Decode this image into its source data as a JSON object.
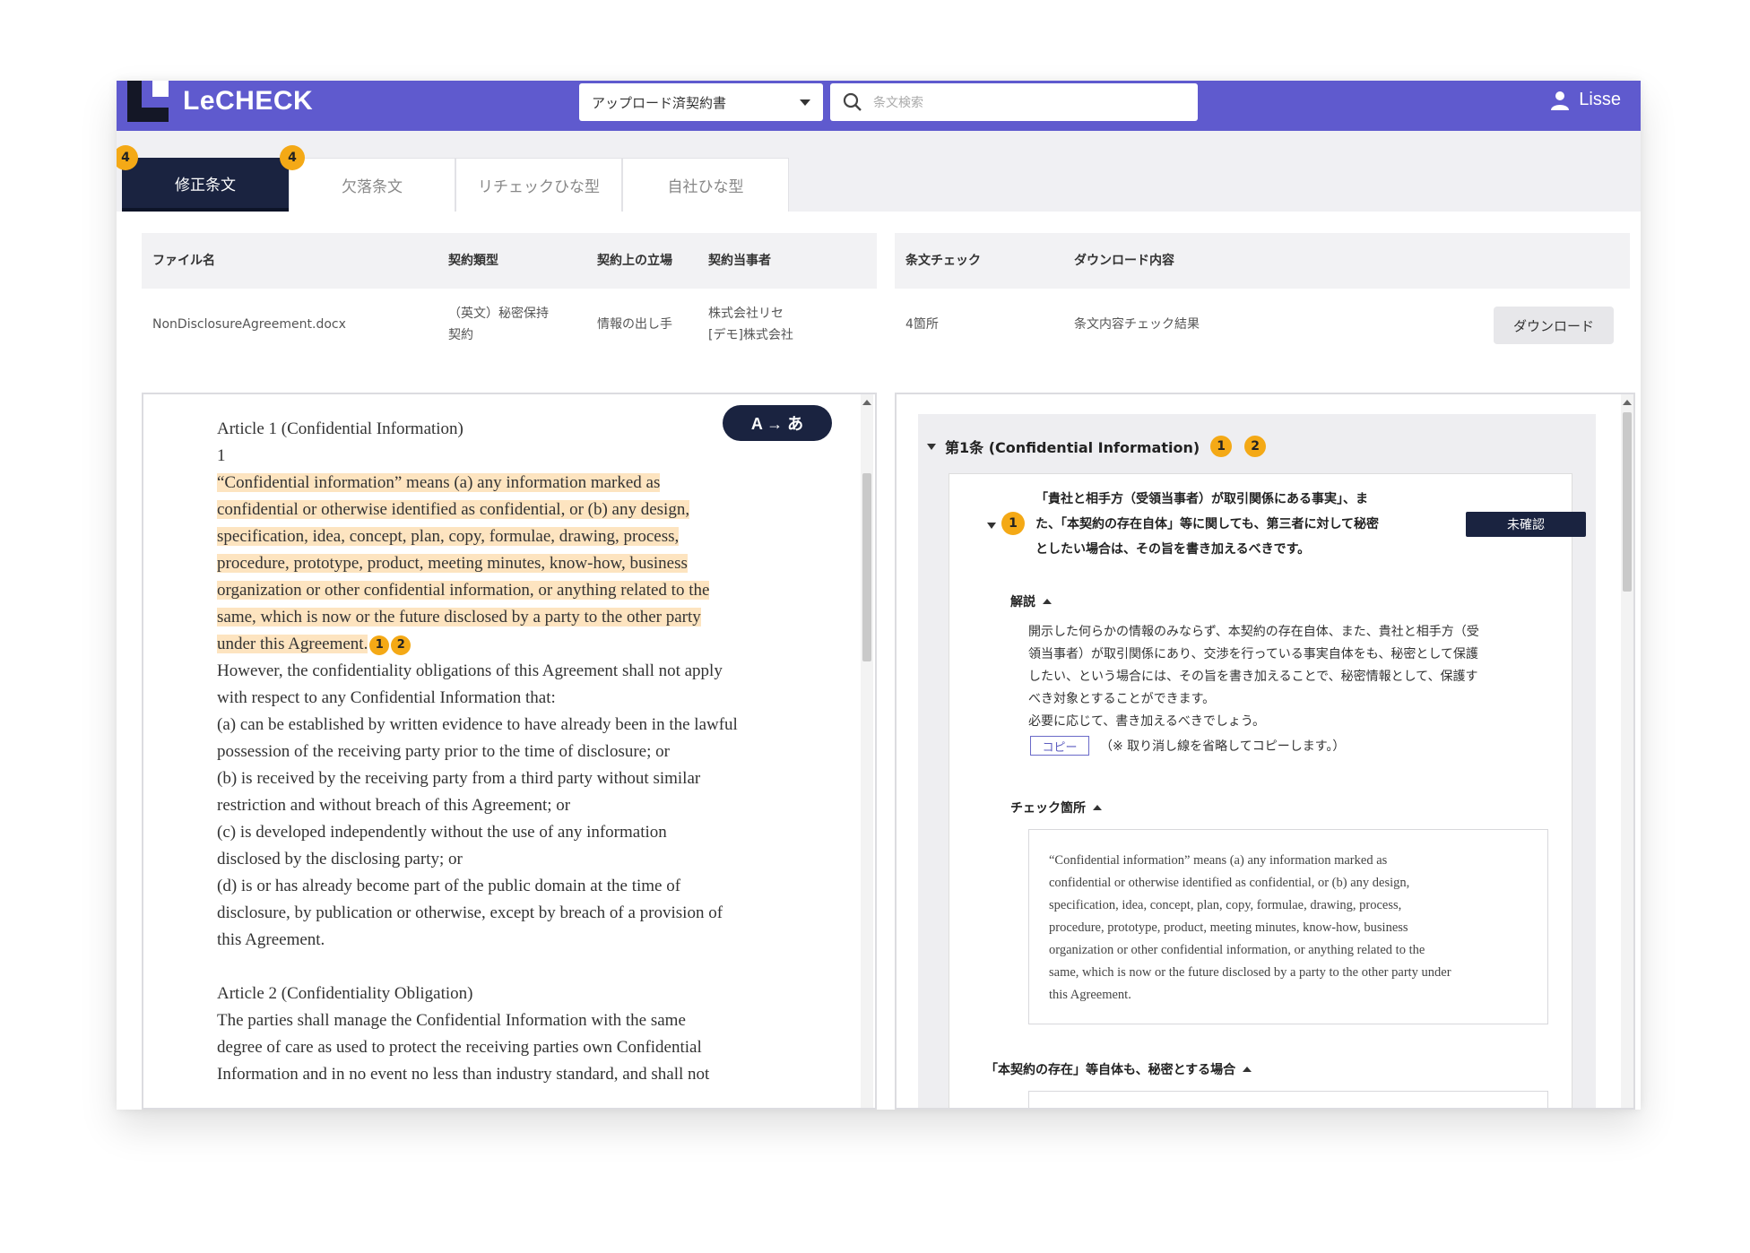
{
  "app": {
    "logo_text": "LeCHECK",
    "accent": "#5f5ace",
    "dark": "#1a2340",
    "badge_color": "#f4a916",
    "highlight": "#fde4c0"
  },
  "header": {
    "contract_select_value": "アップロード済契約書",
    "search_placeholder": "条文検索",
    "user_name": "Lisse"
  },
  "tabs": [
    {
      "label": "修正条文",
      "badge": "4"
    },
    {
      "label": "欠落条文",
      "badge": "4"
    },
    {
      "label": "リチェックひな型"
    },
    {
      "label": "自社ひな型"
    }
  ],
  "file_table": {
    "headers": {
      "file_name": "ファイル名",
      "contract_type": "契約類型",
      "position": "契約上の立場",
      "parties": "契約当事者",
      "clause_check": "条文チェック",
      "download_content": "ダウンロード内容"
    },
    "row": {
      "file_name": "NonDisclosureAgreement.docx",
      "contract_type_1": "（英文）秘密保持",
      "contract_type_2": "契約",
      "position": "情報の出し手",
      "party_1": "株式会社リセ",
      "party_2": "[デモ]株式会社",
      "clause_check": "4箇所",
      "download_content": "条文内容チェック結果",
      "download_button": "ダウンロード"
    }
  },
  "document": {
    "translate_button": "A → あ",
    "article1_title": "Article 1 (Confidential Information)",
    "article1_num": "1",
    "highlight_lines": [
      "“Confidential information” means (a) any information marked as",
      "confidential or otherwise identified as confidential, or (b) any design,",
      "specification, idea, concept, plan, copy, formulae, drawing, process,",
      "procedure, prototype, product, meeting minutes, know-how, business",
      "organization or other confidential information, or anything related to the",
      "same, which is now or the future disclosed by a party to the other party",
      "under this Agreement."
    ],
    "marker_1": "1",
    "marker_2": "2",
    "body_lines": [
      "However, the confidentiality obligations of this Agreement shall not apply",
      "with respect to any Confidential Information that:",
      "(a) can be established by written evidence to have already been in the lawful",
      "possession of the receiving party prior to the time of disclosure; or",
      "(b) is received by the receiving party from a third party without similar",
      "restriction and without breach of this Agreement; or",
      "(c) is developed independently without the use of any information",
      "disclosed by the disclosing party; or",
      "(d) is or has already become part of the public domain at the time of",
      "disclosure, by publication or otherwise, except by breach of a provision of",
      "this Agreement."
    ],
    "article2_title": "Article 2 (Confidentiality Obligation)",
    "article2_lines": [
      "The parties shall manage the Confidential Information with the same",
      "degree of care as used to protect the receiving parties own Confidential",
      "Information and in no event no less than industry standard, and shall not"
    ]
  },
  "review": {
    "article_title": "第1条 (Confidential Information)",
    "badge_1": "1",
    "badge_2": "2",
    "issue_marker": "1",
    "issue_lines": [
      "「貴社と相手方（受領当事者）が取引関係にある事実」、ま",
      "た、「本契約の存在自体」等に関しても、第三者に対して秘密",
      "としたい場合は、その旨を書き加えるべきです。"
    ],
    "status_button": "未確認",
    "explain_heading": "解説",
    "explain_lines": [
      "開示した何らかの情報のみならず、本契約の存在自体、また、貴社と相手方（受",
      "領当事者）が取引関係にあり、交渉を行っている事実自体をも、秘密として保護",
      "したい、という場合には、その旨を書き加えることで、秘密情報として、保護す",
      "べき対象とすることができます。",
      "必要に応じて、書き加えるべきでしょう。"
    ],
    "copy_button": "コピー",
    "copy_note": "（※ 取り消し線を省略してコピーします。）",
    "check_heading": "チェック箇所",
    "check_lines": [
      "“Confidential information” means (a) any information marked as",
      "confidential or otherwise identified as confidential, or (b) any design,",
      "specification, idea, concept, plan, copy, formulae, drawing, process,",
      "procedure, prototype, product, meeting minutes, know-how, business",
      "organization or other confidential information, or anything related to the",
      "same, which is now or the future disclosed by a party to the other party under",
      "this Agreement."
    ],
    "secret_heading": "「本契約の存在」等自体も、秘密とする場合"
  }
}
